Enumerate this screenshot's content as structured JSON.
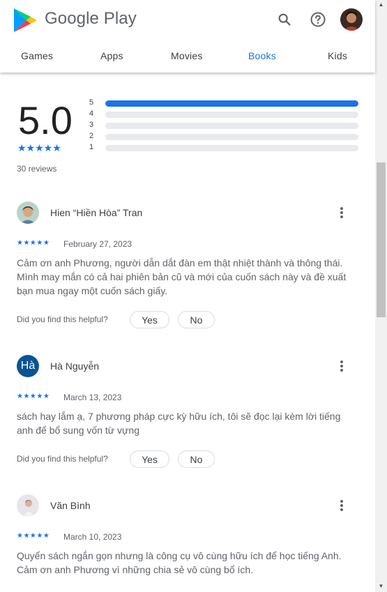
{
  "header": {
    "brand": "Google Play",
    "icons": [
      "google-play-logo",
      "search-icon",
      "help-icon",
      "account-avatar"
    ],
    "tabs": [
      {
        "label": "Games",
        "active": false
      },
      {
        "label": "Apps",
        "active": false
      },
      {
        "label": "Movies",
        "active": false
      },
      {
        "label": "Books",
        "active": true
      },
      {
        "label": "Kids",
        "active": false
      }
    ]
  },
  "summary": {
    "rating": "5.0",
    "stars": "★★★★★",
    "reviews": "30 reviews",
    "distribution": [
      {
        "label": "5",
        "fraction": 1.0
      },
      {
        "label": "4",
        "fraction": 0.0
      },
      {
        "label": "3",
        "fraction": 0.0
      },
      {
        "label": "2",
        "fraction": 0.0
      },
      {
        "label": "1",
        "fraction": 0.0
      }
    ]
  },
  "helpful_prompt": "Did you find this helpful?",
  "yes_label": "Yes",
  "no_label": "No",
  "reviews": [
    {
      "name": "Hien “Hiền Hòa” Tran",
      "stars": "★★★★★",
      "date": "February 27, 2023",
      "text": "Cảm ơn anh Phương, người dẫn dắt đàn em thật nhiệt thành và thông thái. Mình may mắn có cả hai phiên bản cũ và mới của cuốn sách này và đề xuất bạn mua ngay một cuốn sách giấy."
    },
    {
      "name": "Hà Nguyễn",
      "avatar_text": "Hà",
      "stars": "★★★★★",
      "date": "March 13, 2023",
      "text": "sách hay lắm ạ, 7 phương pháp cực kỳ hữu ích, tôi sẽ đọc lại kèm lời tiếng anh để bổ sung vốn từ vựng"
    },
    {
      "name": "Văn Bình",
      "stars": "★★★★★",
      "date": "March 10, 2023",
      "text": "Quyển sách ngắn gọn nhưng là công cụ vô cùng hữu ích để học tiếng Anh. Cảm ơn anh Phương vì những chia sẻ vô cùng bổ ích."
    }
  ],
  "colors": {
    "accent": "#1a73e8",
    "text": "#202124",
    "muted": "#5f6368",
    "track": "#e8eaed"
  }
}
